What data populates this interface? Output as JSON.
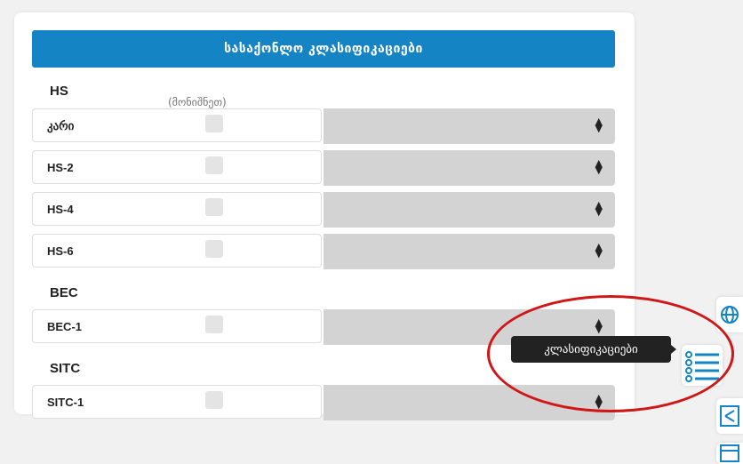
{
  "panel": {
    "title": "სასაქონლო კლასიფიკაციები",
    "hs_label": "HS",
    "hs_note": "(მონიშნეთ)",
    "bec_label": "BEC",
    "sitc_label": "SITC"
  },
  "rows": [
    {
      "label": "კარი",
      "select": ""
    },
    {
      "label": "HS-2",
      "select": ""
    },
    {
      "label": "HS-4",
      "select": ""
    },
    {
      "label": "HS-6",
      "select": ""
    },
    {
      "label": "BEC-1",
      "select": ""
    },
    {
      "label": "SITC-1",
      "select": ""
    }
  ],
  "tooltip": {
    "text": "კლასიფიკაციები"
  },
  "colors": {
    "accent": "#1484c5",
    "highlight_oval": "#d01616"
  },
  "side_icons": [
    "globe-icon",
    "list-icon",
    "share-icon",
    "table-icon"
  ]
}
